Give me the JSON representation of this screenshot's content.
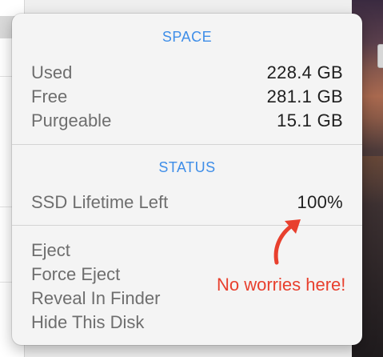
{
  "popover": {
    "space_title": "SPACE",
    "space_rows": [
      {
        "label": "Used",
        "value": "228.4 GB"
      },
      {
        "label": "Free",
        "value": "281.1 GB"
      },
      {
        "label": "Purgeable",
        "value": "15.1 GB"
      }
    ],
    "status_title": "STATUS",
    "status_row": {
      "label": "SSD Lifetime Left",
      "value": "100%"
    },
    "actions": [
      "Eject",
      "Force Eject",
      "Reveal In Finder",
      "Hide This Disk"
    ]
  },
  "annotation": {
    "text": "No worries here!",
    "color": "#e8402e",
    "arrow_icon": "curved-arrow-up-icon"
  },
  "colors": {
    "section_title": "#3f8ee8",
    "label": "#6e6e6e",
    "value": "#1f1f1f",
    "panel_bg": "#f4f4f4"
  }
}
